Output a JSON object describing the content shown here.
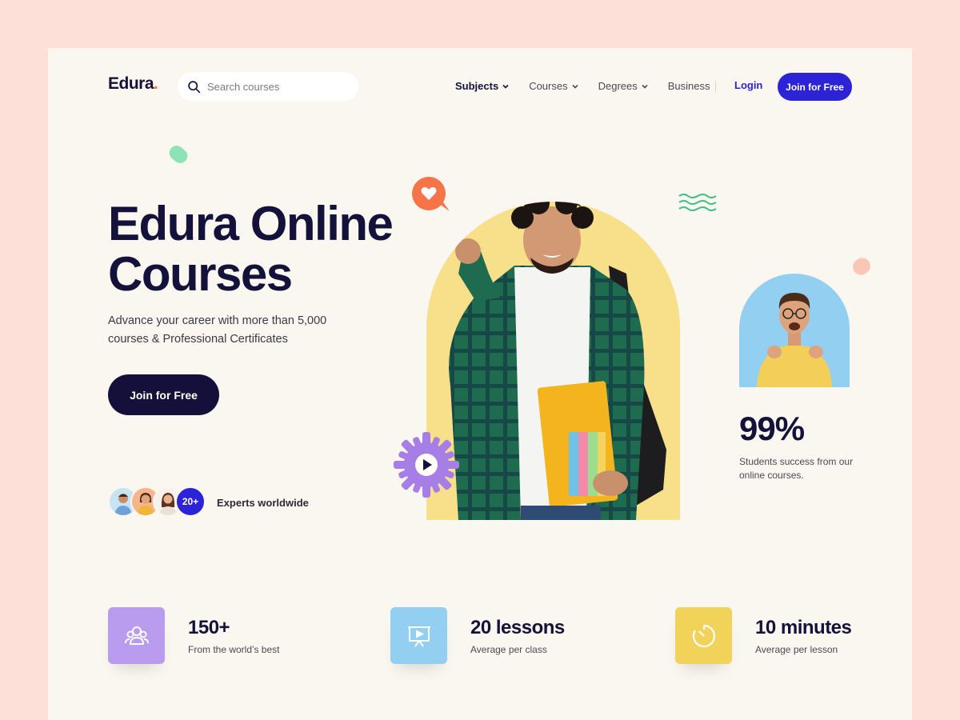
{
  "brand": {
    "name": "Edura",
    "dot": "."
  },
  "search": {
    "placeholder": "Search courses"
  },
  "nav": {
    "items": [
      {
        "label": "Subjects",
        "dropdown": true,
        "active": true
      },
      {
        "label": "Courses",
        "dropdown": true,
        "active": false
      },
      {
        "label": "Degrees",
        "dropdown": true,
        "active": false
      },
      {
        "label": "Business",
        "dropdown": false,
        "active": false
      }
    ],
    "login": "Login",
    "join": "Join for Free"
  },
  "hero": {
    "title_line1": "Edura Online",
    "title_line2": "Courses",
    "subtitle": "Advance your career with more than 5,000 courses & Professional Certificates",
    "cta": "Join for Free",
    "experts_count": "20+",
    "experts_label": "Experts worldwide"
  },
  "success": {
    "value": "99%",
    "label": "Students success from our online courses."
  },
  "stats": [
    {
      "value": "150+",
      "label": "From the world’s best",
      "icon": "users-icon",
      "color": "#b99ced"
    },
    {
      "value": "20 lessons",
      "label": "Average per class",
      "icon": "presentation-icon",
      "color": "#93cff0"
    },
    {
      "value": "10 minutes",
      "label": "Average per lesson",
      "icon": "timer-icon",
      "color": "#f1d35a"
    }
  ],
  "colors": {
    "primary": "#2c23d6",
    "dark": "#14103a",
    "page_bg": "#fde0d8",
    "card_bg": "#faf6f0",
    "arch_yellow": "#f8df8a",
    "arch_blue": "#93cff0",
    "accent_orange": "#f57448",
    "accent_purple": "#a77ee6",
    "accent_green": "#3fbf87"
  }
}
